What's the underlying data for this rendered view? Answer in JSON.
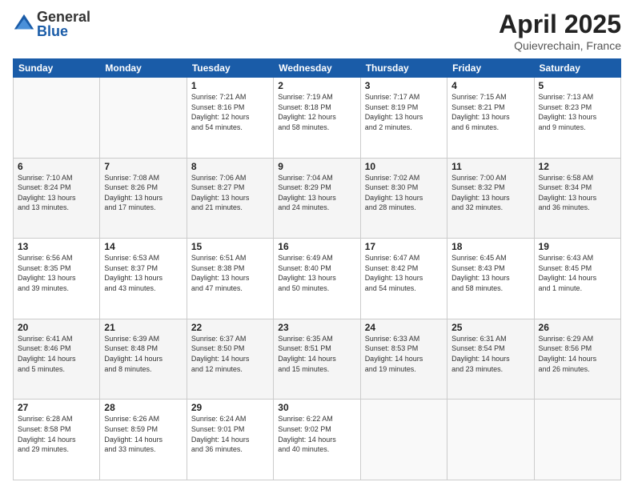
{
  "header": {
    "logo_general": "General",
    "logo_blue": "Blue",
    "title": "April 2025",
    "location": "Quievrechain, France"
  },
  "calendar": {
    "days_of_week": [
      "Sunday",
      "Monday",
      "Tuesday",
      "Wednesday",
      "Thursday",
      "Friday",
      "Saturday"
    ],
    "weeks": [
      [
        {
          "day": "",
          "info": ""
        },
        {
          "day": "",
          "info": ""
        },
        {
          "day": "1",
          "info": "Sunrise: 7:21 AM\nSunset: 8:16 PM\nDaylight: 12 hours\nand 54 minutes."
        },
        {
          "day": "2",
          "info": "Sunrise: 7:19 AM\nSunset: 8:18 PM\nDaylight: 12 hours\nand 58 minutes."
        },
        {
          "day": "3",
          "info": "Sunrise: 7:17 AM\nSunset: 8:19 PM\nDaylight: 13 hours\nand 2 minutes."
        },
        {
          "day": "4",
          "info": "Sunrise: 7:15 AM\nSunset: 8:21 PM\nDaylight: 13 hours\nand 6 minutes."
        },
        {
          "day": "5",
          "info": "Sunrise: 7:13 AM\nSunset: 8:23 PM\nDaylight: 13 hours\nand 9 minutes."
        }
      ],
      [
        {
          "day": "6",
          "info": "Sunrise: 7:10 AM\nSunset: 8:24 PM\nDaylight: 13 hours\nand 13 minutes."
        },
        {
          "day": "7",
          "info": "Sunrise: 7:08 AM\nSunset: 8:26 PM\nDaylight: 13 hours\nand 17 minutes."
        },
        {
          "day": "8",
          "info": "Sunrise: 7:06 AM\nSunset: 8:27 PM\nDaylight: 13 hours\nand 21 minutes."
        },
        {
          "day": "9",
          "info": "Sunrise: 7:04 AM\nSunset: 8:29 PM\nDaylight: 13 hours\nand 24 minutes."
        },
        {
          "day": "10",
          "info": "Sunrise: 7:02 AM\nSunset: 8:30 PM\nDaylight: 13 hours\nand 28 minutes."
        },
        {
          "day": "11",
          "info": "Sunrise: 7:00 AM\nSunset: 8:32 PM\nDaylight: 13 hours\nand 32 minutes."
        },
        {
          "day": "12",
          "info": "Sunrise: 6:58 AM\nSunset: 8:34 PM\nDaylight: 13 hours\nand 36 minutes."
        }
      ],
      [
        {
          "day": "13",
          "info": "Sunrise: 6:56 AM\nSunset: 8:35 PM\nDaylight: 13 hours\nand 39 minutes."
        },
        {
          "day": "14",
          "info": "Sunrise: 6:53 AM\nSunset: 8:37 PM\nDaylight: 13 hours\nand 43 minutes."
        },
        {
          "day": "15",
          "info": "Sunrise: 6:51 AM\nSunset: 8:38 PM\nDaylight: 13 hours\nand 47 minutes."
        },
        {
          "day": "16",
          "info": "Sunrise: 6:49 AM\nSunset: 8:40 PM\nDaylight: 13 hours\nand 50 minutes."
        },
        {
          "day": "17",
          "info": "Sunrise: 6:47 AM\nSunset: 8:42 PM\nDaylight: 13 hours\nand 54 minutes."
        },
        {
          "day": "18",
          "info": "Sunrise: 6:45 AM\nSunset: 8:43 PM\nDaylight: 13 hours\nand 58 minutes."
        },
        {
          "day": "19",
          "info": "Sunrise: 6:43 AM\nSunset: 8:45 PM\nDaylight: 14 hours\nand 1 minute."
        }
      ],
      [
        {
          "day": "20",
          "info": "Sunrise: 6:41 AM\nSunset: 8:46 PM\nDaylight: 14 hours\nand 5 minutes."
        },
        {
          "day": "21",
          "info": "Sunrise: 6:39 AM\nSunset: 8:48 PM\nDaylight: 14 hours\nand 8 minutes."
        },
        {
          "day": "22",
          "info": "Sunrise: 6:37 AM\nSunset: 8:50 PM\nDaylight: 14 hours\nand 12 minutes."
        },
        {
          "day": "23",
          "info": "Sunrise: 6:35 AM\nSunset: 8:51 PM\nDaylight: 14 hours\nand 15 minutes."
        },
        {
          "day": "24",
          "info": "Sunrise: 6:33 AM\nSunset: 8:53 PM\nDaylight: 14 hours\nand 19 minutes."
        },
        {
          "day": "25",
          "info": "Sunrise: 6:31 AM\nSunset: 8:54 PM\nDaylight: 14 hours\nand 23 minutes."
        },
        {
          "day": "26",
          "info": "Sunrise: 6:29 AM\nSunset: 8:56 PM\nDaylight: 14 hours\nand 26 minutes."
        }
      ],
      [
        {
          "day": "27",
          "info": "Sunrise: 6:28 AM\nSunset: 8:58 PM\nDaylight: 14 hours\nand 29 minutes."
        },
        {
          "day": "28",
          "info": "Sunrise: 6:26 AM\nSunset: 8:59 PM\nDaylight: 14 hours\nand 33 minutes."
        },
        {
          "day": "29",
          "info": "Sunrise: 6:24 AM\nSunset: 9:01 PM\nDaylight: 14 hours\nand 36 minutes."
        },
        {
          "day": "30",
          "info": "Sunrise: 6:22 AM\nSunset: 9:02 PM\nDaylight: 14 hours\nand 40 minutes."
        },
        {
          "day": "",
          "info": ""
        },
        {
          "day": "",
          "info": ""
        },
        {
          "day": "",
          "info": ""
        }
      ]
    ]
  }
}
